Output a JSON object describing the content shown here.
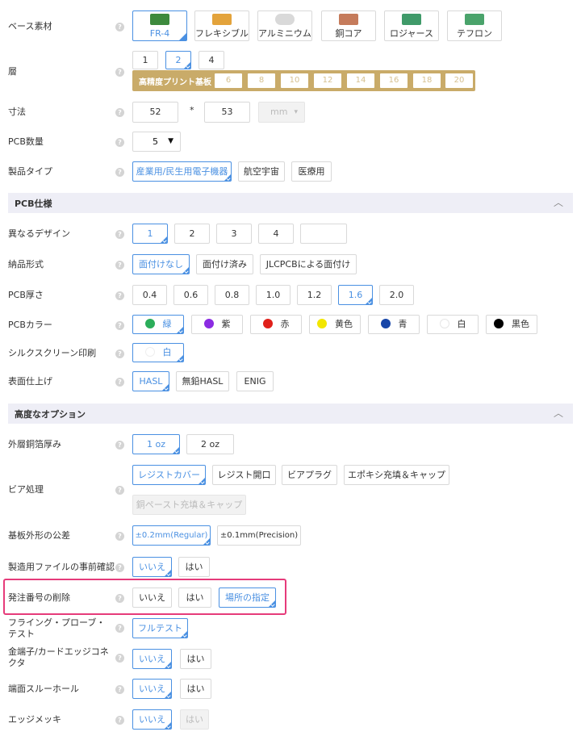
{
  "base_material": {
    "label": "ベース素材",
    "options": [
      "FR-4",
      "フレキシブル",
      "アルミニウム",
      "銅コア",
      "ロジャース",
      "テフロン"
    ]
  },
  "layers": {
    "label": "層",
    "options": [
      "1",
      "2",
      "4"
    ],
    "hd_label": "高精度プリント基板",
    "hd_options": [
      "6",
      "8",
      "10",
      "12",
      "14",
      "16",
      "18",
      "20"
    ]
  },
  "dimensions": {
    "label": "寸法",
    "width": "52",
    "sep": "*",
    "height": "53",
    "unit": "mm"
  },
  "quantity": {
    "label": "PCB数量",
    "value": "5"
  },
  "product_type": {
    "label": "製品タイプ",
    "options": [
      "産業用/民生用電子機器",
      "航空宇宙",
      "医療用"
    ]
  },
  "pcb_spec": {
    "title": "PCB仕様",
    "different_design": {
      "label": "異なるデザイン",
      "options": [
        "1",
        "2",
        "3",
        "4",
        ""
      ]
    },
    "delivery_format": {
      "label": "納品形式",
      "options": [
        "面付けなし",
        "面付け済み",
        "JLCPCBによる面付け"
      ]
    },
    "thickness": {
      "label": "PCB厚さ",
      "options": [
        "0.4",
        "0.6",
        "0.8",
        "1.0",
        "1.2",
        "1.6",
        "2.0"
      ]
    },
    "color": {
      "label": "PCBカラー",
      "options": [
        {
          "name": "緑",
          "color": "#2bad5a"
        },
        {
          "name": "紫",
          "color": "#8b2be2"
        },
        {
          "name": "赤",
          "color": "#e0201a"
        },
        {
          "name": "黄色",
          "color": "#f2e600"
        },
        {
          "name": "青",
          "color": "#1645a8"
        },
        {
          "name": "白",
          "color": "#ffffff"
        },
        {
          "name": "黒色",
          "color": "#000000"
        }
      ]
    },
    "silkscreen": {
      "label": "シルクスクリーン印刷",
      "option": "白"
    },
    "surface_finish": {
      "label": "表面仕上げ",
      "options": [
        "HASL",
        "無鉛HASL",
        "ENIG"
      ]
    }
  },
  "advanced": {
    "title": "高度なオプション",
    "outer_copper": {
      "label": "外層銅箔厚み",
      "options": [
        "1 oz",
        "2 oz"
      ]
    },
    "via": {
      "label": "ビア処理",
      "options": [
        "レジストカバー",
        "レジスト開口",
        "ビアプラグ",
        "エポキシ充填＆キャップ",
        "銅ペースト充填＆キャップ"
      ]
    },
    "tolerance": {
      "label": "基板外形の公差",
      "options": [
        "±0.2mm(Regular)",
        "±0.1mm(Precision)"
      ]
    },
    "confirm": {
      "label": "製造用ファイルの事前確認",
      "options": [
        "いいえ",
        "はい"
      ]
    },
    "order_number": {
      "label": "発注番号の削除",
      "options": [
        "いいえ",
        "はい",
        "場所の指定"
      ]
    },
    "flying_probe": {
      "label": "フライング・プローブ・テスト",
      "option": "フルテスト"
    },
    "gold_finger": {
      "label": "金端子/カードエッジコネクタ",
      "options": [
        "いいえ",
        "はい"
      ]
    },
    "castellated": {
      "label": "端面スルーホール",
      "options": [
        "いいえ",
        "はい"
      ]
    },
    "edge_plating": {
      "label": "エッジメッキ",
      "options": [
        "いいえ",
        "はい"
      ]
    }
  },
  "colors": {
    "accent": "#4a90e2",
    "highlight": "#e63b7a",
    "gold": "#c9ab69"
  }
}
